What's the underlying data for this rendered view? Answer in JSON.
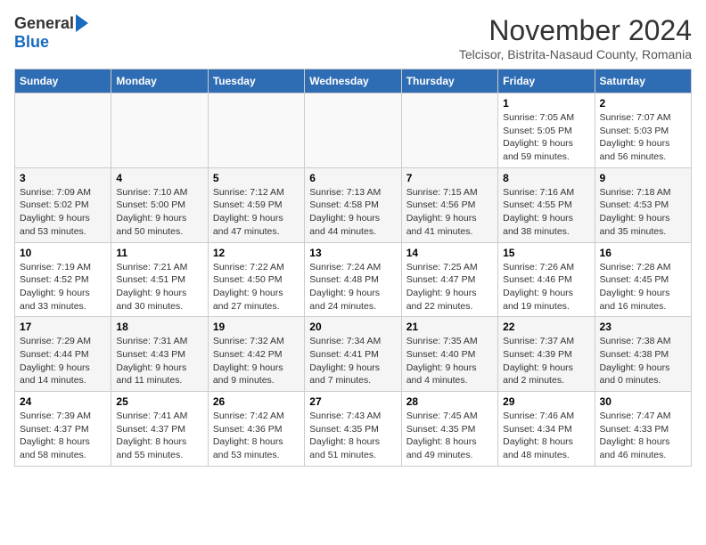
{
  "logo": {
    "general": "General",
    "blue": "Blue"
  },
  "title": "November 2024",
  "subtitle": "Telcisor, Bistrita-Nasaud County, Romania",
  "weekdays": [
    "Sunday",
    "Monday",
    "Tuesday",
    "Wednesday",
    "Thursday",
    "Friday",
    "Saturday"
  ],
  "weeks": [
    [
      {
        "day": "",
        "info": ""
      },
      {
        "day": "",
        "info": ""
      },
      {
        "day": "",
        "info": ""
      },
      {
        "day": "",
        "info": ""
      },
      {
        "day": "",
        "info": ""
      },
      {
        "day": "1",
        "info": "Sunrise: 7:05 AM\nSunset: 5:05 PM\nDaylight: 9 hours and 59 minutes."
      },
      {
        "day": "2",
        "info": "Sunrise: 7:07 AM\nSunset: 5:03 PM\nDaylight: 9 hours and 56 minutes."
      }
    ],
    [
      {
        "day": "3",
        "info": "Sunrise: 7:09 AM\nSunset: 5:02 PM\nDaylight: 9 hours and 53 minutes."
      },
      {
        "day": "4",
        "info": "Sunrise: 7:10 AM\nSunset: 5:00 PM\nDaylight: 9 hours and 50 minutes."
      },
      {
        "day": "5",
        "info": "Sunrise: 7:12 AM\nSunset: 4:59 PM\nDaylight: 9 hours and 47 minutes."
      },
      {
        "day": "6",
        "info": "Sunrise: 7:13 AM\nSunset: 4:58 PM\nDaylight: 9 hours and 44 minutes."
      },
      {
        "day": "7",
        "info": "Sunrise: 7:15 AM\nSunset: 4:56 PM\nDaylight: 9 hours and 41 minutes."
      },
      {
        "day": "8",
        "info": "Sunrise: 7:16 AM\nSunset: 4:55 PM\nDaylight: 9 hours and 38 minutes."
      },
      {
        "day": "9",
        "info": "Sunrise: 7:18 AM\nSunset: 4:53 PM\nDaylight: 9 hours and 35 minutes."
      }
    ],
    [
      {
        "day": "10",
        "info": "Sunrise: 7:19 AM\nSunset: 4:52 PM\nDaylight: 9 hours and 33 minutes."
      },
      {
        "day": "11",
        "info": "Sunrise: 7:21 AM\nSunset: 4:51 PM\nDaylight: 9 hours and 30 minutes."
      },
      {
        "day": "12",
        "info": "Sunrise: 7:22 AM\nSunset: 4:50 PM\nDaylight: 9 hours and 27 minutes."
      },
      {
        "day": "13",
        "info": "Sunrise: 7:24 AM\nSunset: 4:48 PM\nDaylight: 9 hours and 24 minutes."
      },
      {
        "day": "14",
        "info": "Sunrise: 7:25 AM\nSunset: 4:47 PM\nDaylight: 9 hours and 22 minutes."
      },
      {
        "day": "15",
        "info": "Sunrise: 7:26 AM\nSunset: 4:46 PM\nDaylight: 9 hours and 19 minutes."
      },
      {
        "day": "16",
        "info": "Sunrise: 7:28 AM\nSunset: 4:45 PM\nDaylight: 9 hours and 16 minutes."
      }
    ],
    [
      {
        "day": "17",
        "info": "Sunrise: 7:29 AM\nSunset: 4:44 PM\nDaylight: 9 hours and 14 minutes."
      },
      {
        "day": "18",
        "info": "Sunrise: 7:31 AM\nSunset: 4:43 PM\nDaylight: 9 hours and 11 minutes."
      },
      {
        "day": "19",
        "info": "Sunrise: 7:32 AM\nSunset: 4:42 PM\nDaylight: 9 hours and 9 minutes."
      },
      {
        "day": "20",
        "info": "Sunrise: 7:34 AM\nSunset: 4:41 PM\nDaylight: 9 hours and 7 minutes."
      },
      {
        "day": "21",
        "info": "Sunrise: 7:35 AM\nSunset: 4:40 PM\nDaylight: 9 hours and 4 minutes."
      },
      {
        "day": "22",
        "info": "Sunrise: 7:37 AM\nSunset: 4:39 PM\nDaylight: 9 hours and 2 minutes."
      },
      {
        "day": "23",
        "info": "Sunrise: 7:38 AM\nSunset: 4:38 PM\nDaylight: 9 hours and 0 minutes."
      }
    ],
    [
      {
        "day": "24",
        "info": "Sunrise: 7:39 AM\nSunset: 4:37 PM\nDaylight: 8 hours and 58 minutes."
      },
      {
        "day": "25",
        "info": "Sunrise: 7:41 AM\nSunset: 4:37 PM\nDaylight: 8 hours and 55 minutes."
      },
      {
        "day": "26",
        "info": "Sunrise: 7:42 AM\nSunset: 4:36 PM\nDaylight: 8 hours and 53 minutes."
      },
      {
        "day": "27",
        "info": "Sunrise: 7:43 AM\nSunset: 4:35 PM\nDaylight: 8 hours and 51 minutes."
      },
      {
        "day": "28",
        "info": "Sunrise: 7:45 AM\nSunset: 4:35 PM\nDaylight: 8 hours and 49 minutes."
      },
      {
        "day": "29",
        "info": "Sunrise: 7:46 AM\nSunset: 4:34 PM\nDaylight: 8 hours and 48 minutes."
      },
      {
        "day": "30",
        "info": "Sunrise: 7:47 AM\nSunset: 4:33 PM\nDaylight: 8 hours and 46 minutes."
      }
    ]
  ]
}
